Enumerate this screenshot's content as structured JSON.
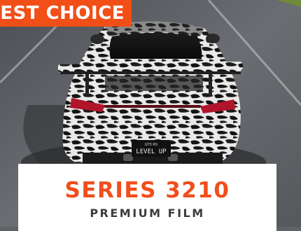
{
  "badge": {
    "text": "BEST CHOICE"
  },
  "plate": {
    "top": "GT3 RS",
    "main": "LEVEL UP"
  },
  "product": {
    "title": "SERIES 3210",
    "subtitle": "PREMIUM FILM"
  },
  "colors": {
    "accent": "#f24e17",
    "asphalt": "#5f6266",
    "subtitle": "#3c3c3c"
  }
}
